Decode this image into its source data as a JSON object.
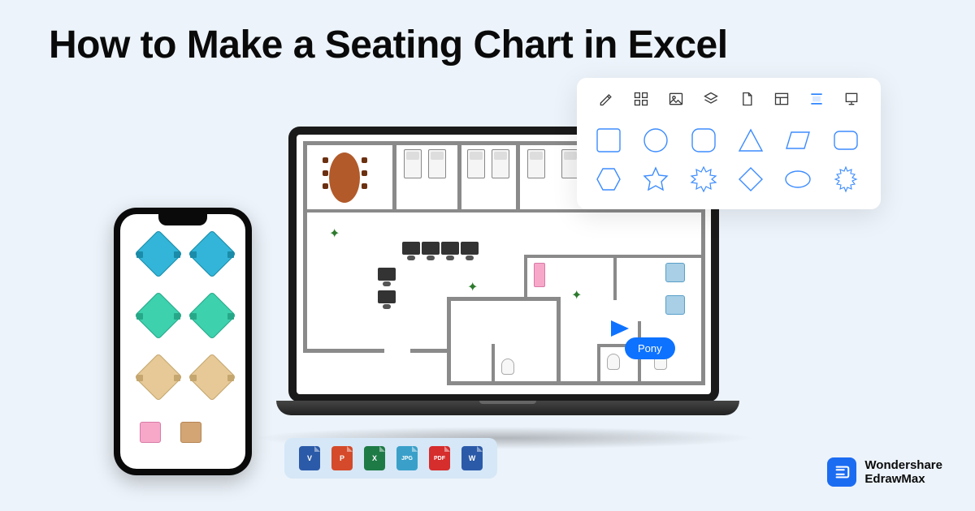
{
  "title": "How to Make a Seating Chart in Excel",
  "cursor_label": "Pony",
  "toolbar_icons": [
    {
      "name": "format-icon"
    },
    {
      "name": "components-icon"
    },
    {
      "name": "image-icon"
    },
    {
      "name": "layers-icon"
    },
    {
      "name": "page-icon"
    },
    {
      "name": "layout-icon"
    },
    {
      "name": "distribute-icon",
      "active": true
    },
    {
      "name": "presentation-icon"
    }
  ],
  "shapes": [
    "square",
    "circle",
    "rounded-square",
    "triangle",
    "parallelogram",
    "rounded-rect",
    "hexagon",
    "star",
    "burst-8",
    "diamond",
    "ellipse",
    "burst-12"
  ],
  "export_formats": [
    {
      "label": "V",
      "color": "#2b5aa8",
      "name": "visio"
    },
    {
      "label": "P",
      "color": "#d54a2a",
      "name": "powerpoint"
    },
    {
      "label": "X",
      "color": "#1e7b46",
      "name": "excel"
    },
    {
      "label": "JPG",
      "color": "#3aa0c9",
      "name": "jpg"
    },
    {
      "label": "PDF",
      "color": "#d62d2d",
      "name": "pdf"
    },
    {
      "label": "W",
      "color": "#2b5aa8",
      "name": "word"
    }
  ],
  "brand": {
    "line1": "Wondershare",
    "line2": "EdrawMax"
  }
}
